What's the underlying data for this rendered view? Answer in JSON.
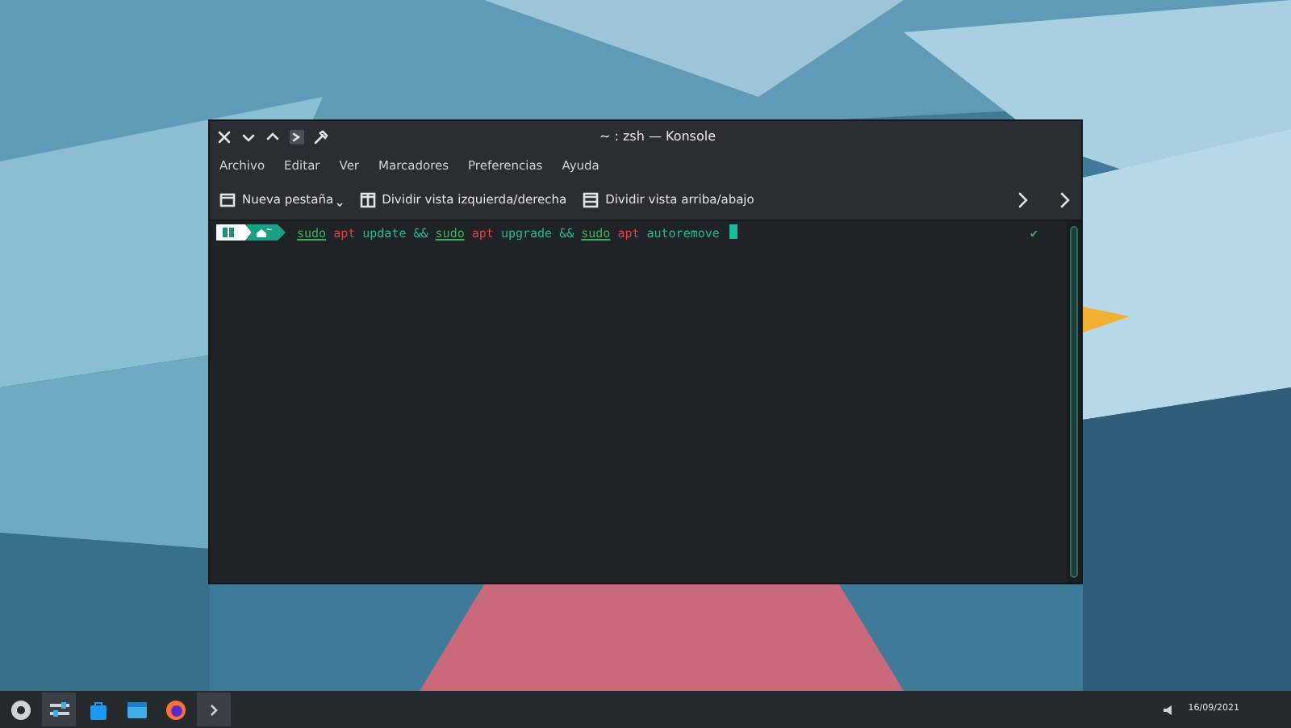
{
  "window": {
    "title": "~ : zsh — Konsole"
  },
  "menu": [
    "Archivo",
    "Editar",
    "Ver",
    "Marcadores",
    "Preferencias",
    "Ayuda"
  ],
  "toolbar": [
    {
      "label": "Nueva pestaña",
      "has_menu": true
    },
    {
      "label": "Dividir vista izquierda/derecha",
      "has_menu": false
    },
    {
      "label": "Dividir vista arriba/abajo",
      "has_menu": false
    }
  ],
  "prompt": {
    "dir": "~",
    "status": "✔"
  },
  "command": [
    {
      "text": "sudo",
      "kind": "builtin"
    },
    {
      "text": "apt",
      "kind": "error"
    },
    {
      "text": "update",
      "kind": "arg"
    },
    {
      "text": "&&",
      "kind": "arg"
    },
    {
      "text": "sudo",
      "kind": "builtin"
    },
    {
      "text": "apt",
      "kind": "error"
    },
    {
      "text": "upgrade",
      "kind": "arg"
    },
    {
      "text": "&&",
      "kind": "arg"
    },
    {
      "text": "sudo",
      "kind": "builtin"
    },
    {
      "text": "apt",
      "kind": "error"
    },
    {
      "text": "autoremove",
      "kind": "arg"
    }
  ],
  "taskbar": {
    "apps": [
      {
        "active": false
      },
      {
        "active": true
      },
      {
        "active": false
      },
      {
        "active": false
      },
      {
        "active": false
      },
      {
        "active": true
      }
    ],
    "date": "16/09/2021"
  }
}
